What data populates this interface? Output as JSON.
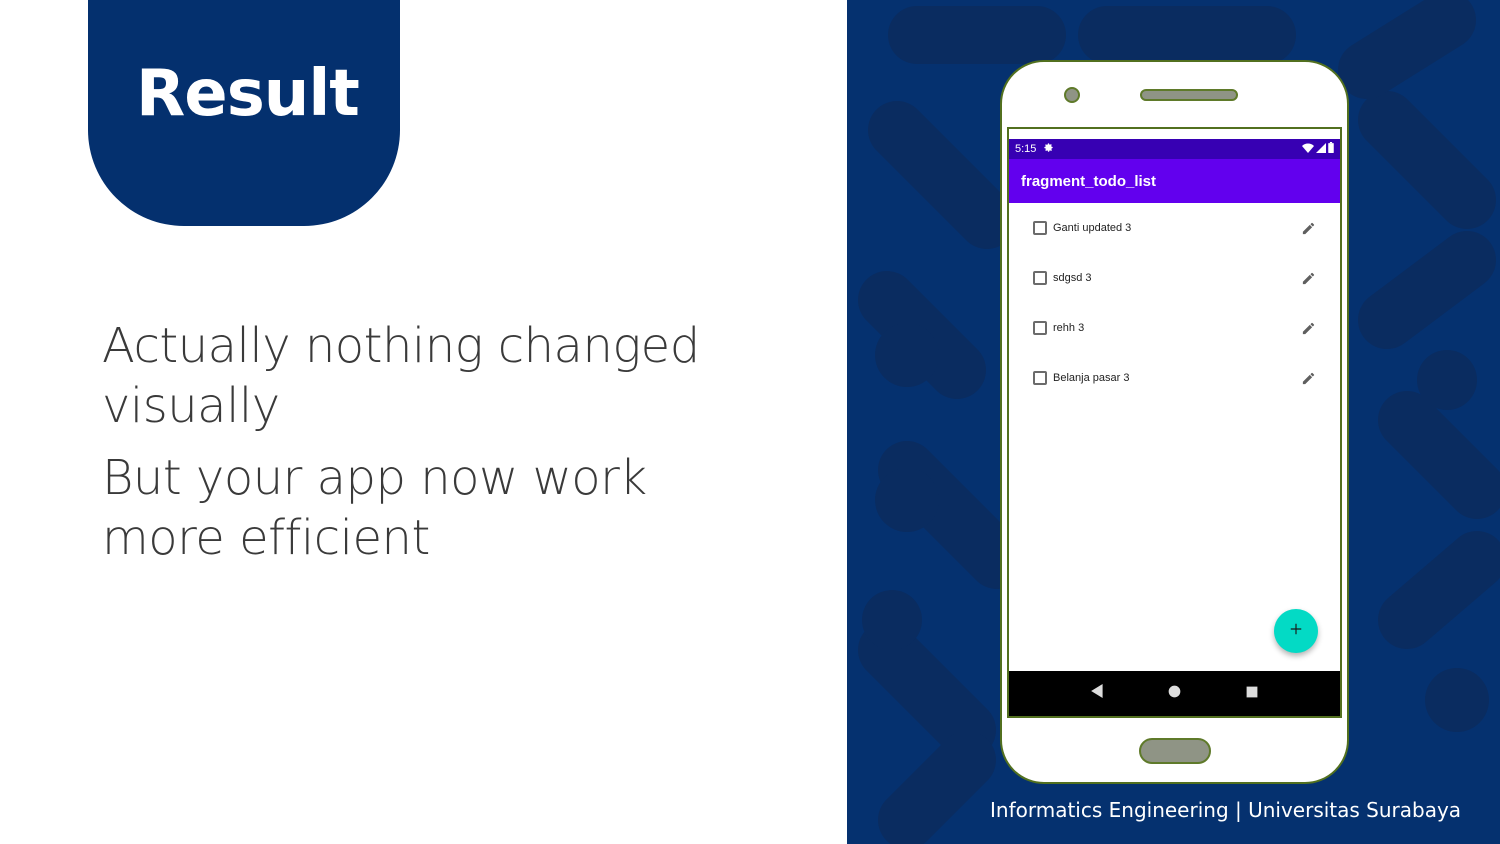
{
  "slide": {
    "title": "Result",
    "paragraphs": [
      "Actually nothing changed visually",
      "But your app now work more efficient"
    ],
    "footer": "Informatics Engineering | Universitas Surabaya"
  },
  "phone": {
    "status_bar": {
      "time": "5:15",
      "icons": [
        "gear-icon",
        "wifi-icon",
        "signal-icon",
        "battery-icon"
      ]
    },
    "app_bar": {
      "title": "fragment_todo_list"
    },
    "todo_items": [
      {
        "text": "Ganti updated 3",
        "checked": false
      },
      {
        "text": "sdgsd 3",
        "checked": false
      },
      {
        "text": "rehh 3",
        "checked": false
      },
      {
        "text": "Belanja pasar 3",
        "checked": false
      }
    ],
    "fab": {
      "icon": "plus-icon"
    },
    "nav_bar": {
      "icons": [
        "back-icon",
        "home-icon",
        "recents-icon"
      ]
    }
  },
  "colors": {
    "slide_accent": "#04306e",
    "status_bar": "#3700b3",
    "app_bar": "#6200ee",
    "fab": "#03dac5",
    "nav_bar": "#000000"
  }
}
